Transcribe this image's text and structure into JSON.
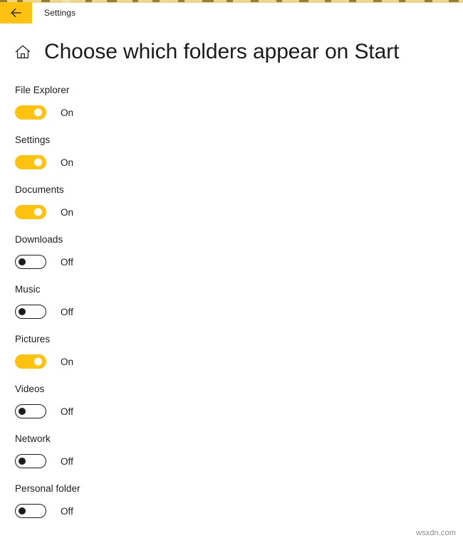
{
  "window": {
    "back_icon": "back-arrow-icon",
    "app_label": "Settings",
    "accent_color": "#ffc20e"
  },
  "page": {
    "home_icon": "home-icon",
    "title": "Choose which folders appear on Start"
  },
  "settings": {
    "on_label": "On",
    "off_label": "Off",
    "rows": [
      {
        "label": "File Explorer",
        "state": "On"
      },
      {
        "label": "Settings",
        "state": "On"
      },
      {
        "label": "Documents",
        "state": "On"
      },
      {
        "label": "Downloads",
        "state": "Off"
      },
      {
        "label": "Music",
        "state": "Off"
      },
      {
        "label": "Pictures",
        "state": "On"
      },
      {
        "label": "Videos",
        "state": "Off"
      },
      {
        "label": "Network",
        "state": "Off"
      },
      {
        "label": "Personal folder",
        "state": "Off"
      }
    ]
  },
  "footer": {
    "watermark": "wsxdn.com"
  }
}
